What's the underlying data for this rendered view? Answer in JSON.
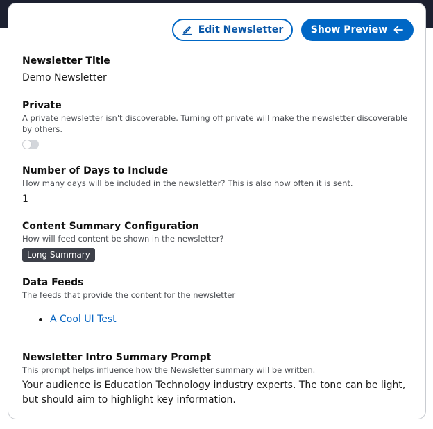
{
  "header": {
    "edit_label": "Edit Newsletter",
    "preview_label": "Show Preview",
    "edit_icon": "pencil-icon",
    "preview_icon": "arrow-left-icon",
    "accent_color": "#0067c5"
  },
  "fields": {
    "title": {
      "label": "Newsletter Title",
      "value": "Demo Newsletter"
    },
    "private": {
      "label": "Private",
      "description": "A private newsletter isn't discoverable. Turning off private will make the newsletter discoverable by others.",
      "enabled": false
    },
    "days": {
      "label": "Number of Days to Include",
      "description": "How many days will be included in the newsletter? This is also how often it is sent.",
      "value": "1"
    },
    "summary_config": {
      "label": "Content Summary Configuration",
      "description": "How will feed content be shown in the newsletter?",
      "value": "Long Summary"
    },
    "feeds": {
      "label": "Data Feeds",
      "description": "The feeds that provide the content for the newsletter",
      "items": [
        "A Cool UI Test"
      ]
    },
    "intro_prompt": {
      "label": "Newsletter Intro Summary Prompt",
      "description": "This prompt helps influence how the Newsletter summary will be written.",
      "value": "Your audience is Education Technology industry experts. The tone can be light, but should aim to highlight key information."
    }
  }
}
